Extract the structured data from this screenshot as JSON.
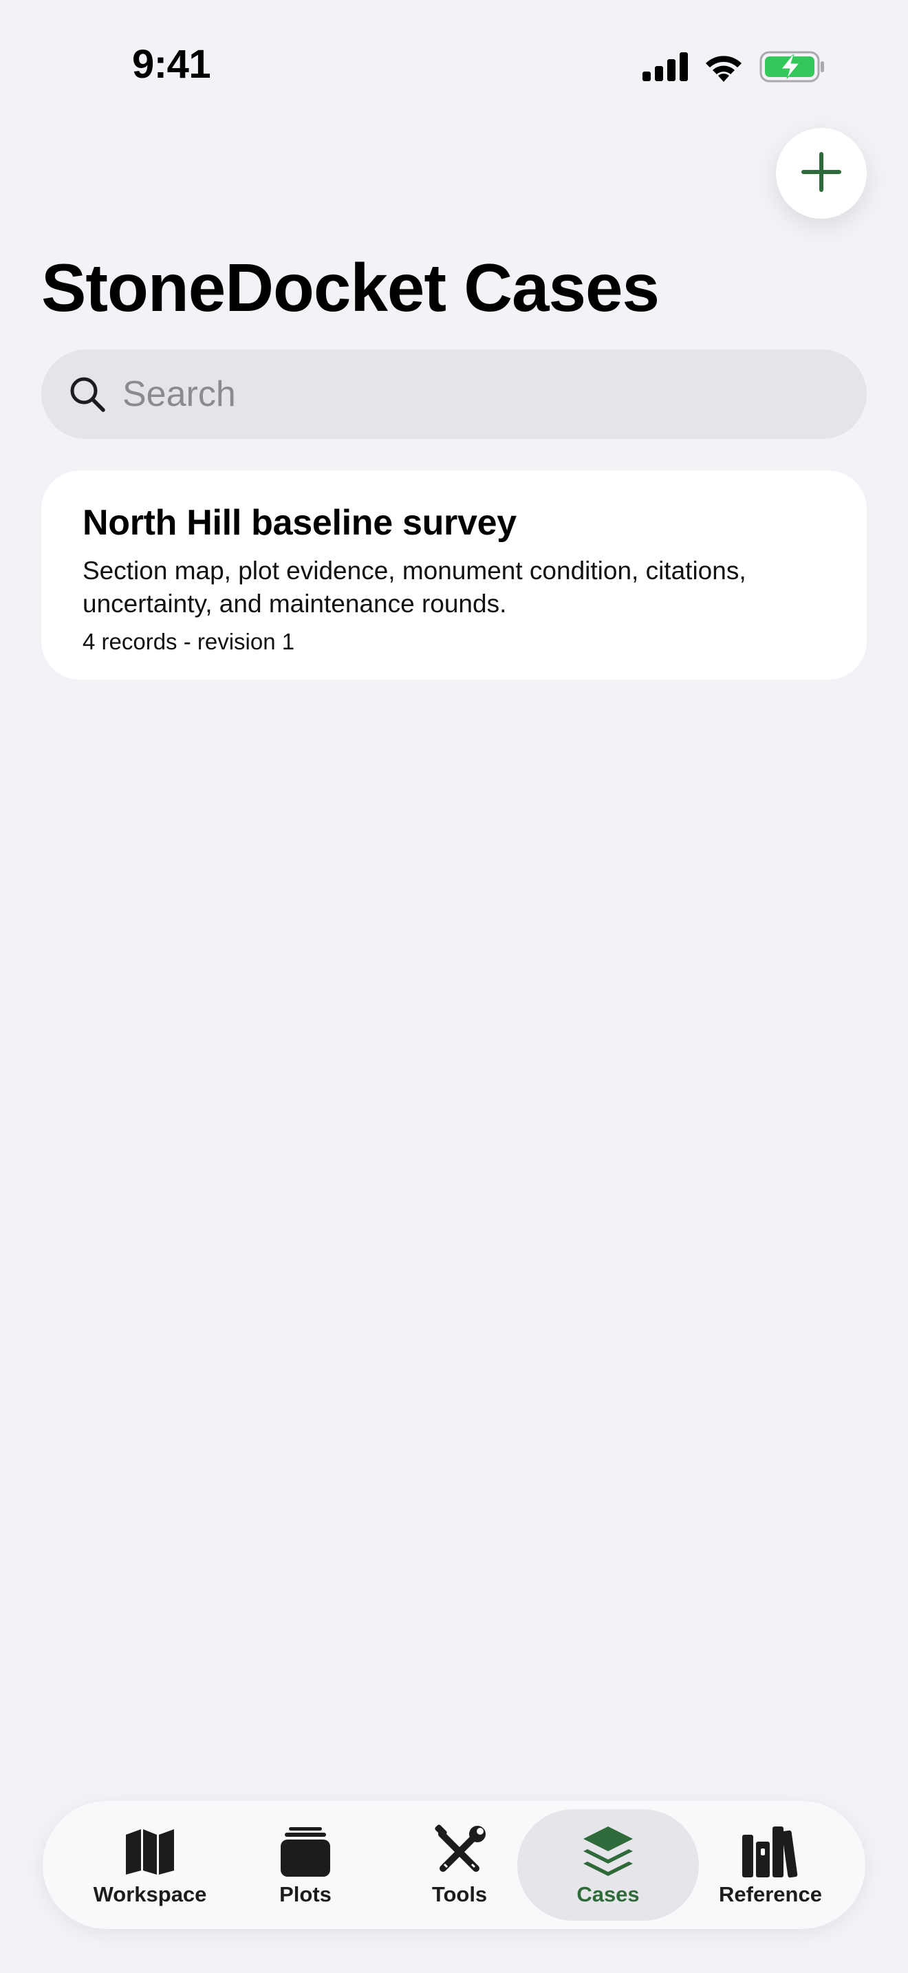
{
  "status_bar": {
    "time": "9:41"
  },
  "header": {
    "title": "StoneDocket Cases",
    "add_button_icon": "plus-icon"
  },
  "search": {
    "placeholder": "Search",
    "value": ""
  },
  "cases": [
    {
      "title": "North Hill baseline survey",
      "description": "Section map, plot evidence, monument condition, citations, uncertainty, and maintenance rounds.",
      "meta": "4 records - revision 1"
    }
  ],
  "tab_bar": {
    "tabs": [
      {
        "label": "Workspace",
        "icon": "map-icon",
        "active": false
      },
      {
        "label": "Plots",
        "icon": "stack-icon",
        "active": false
      },
      {
        "label": "Tools",
        "icon": "tools-icon",
        "active": false
      },
      {
        "label": "Cases",
        "icon": "layers-icon",
        "active": true
      },
      {
        "label": "Reference",
        "icon": "books-icon",
        "active": false
      }
    ]
  },
  "colors": {
    "accent": "#2f6b3a",
    "background": "#f2f2f7",
    "battery_green": "#34c759"
  }
}
